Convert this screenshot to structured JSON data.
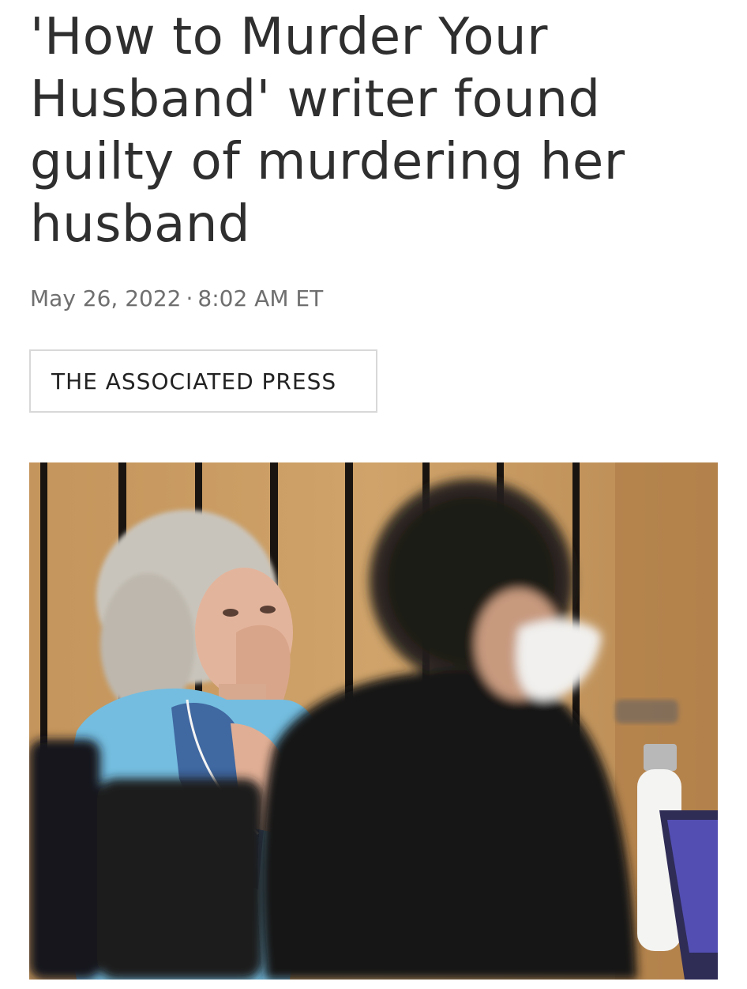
{
  "article": {
    "headline": "'How to Murder Your Husband' writer found guilty of murdering her husband",
    "date": "May 26, 2022",
    "separator": "·",
    "time": "8:02 AM ET",
    "byline": "THE ASSOCIATED PRESS",
    "photo_icon": "courtroom-photo"
  },
  "colors": {
    "headline": "#2f2f2f",
    "dateline": "#6f6f6f",
    "byline_border": "#d8d8d8"
  }
}
